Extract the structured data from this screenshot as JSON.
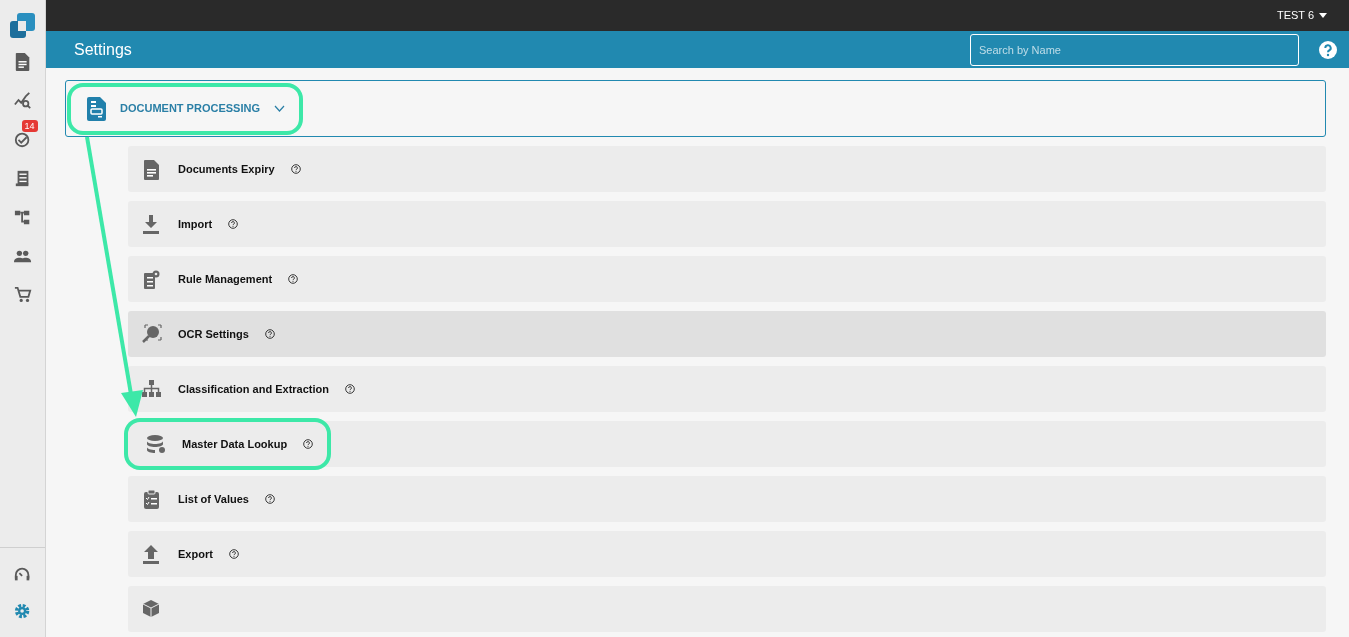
{
  "top_bar": {
    "user": "TEST 6"
  },
  "sidebar": {
    "items": [
      {
        "kind": "document",
        "selected": false
      },
      {
        "kind": "analytics",
        "selected": false
      },
      {
        "kind": "tasks",
        "selected": false,
        "badge": "14"
      },
      {
        "kind": "receipt",
        "selected": false
      },
      {
        "kind": "workflow",
        "selected": false
      },
      {
        "kind": "users",
        "selected": false
      },
      {
        "kind": "cart",
        "selected": false
      }
    ],
    "bottom_items": [
      {
        "kind": "support",
        "selected": false
      },
      {
        "kind": "settings",
        "selected": true
      }
    ]
  },
  "header": {
    "title": "Settings",
    "search": {
      "placeholder": "Search by Name"
    }
  },
  "section": {
    "title": "DOCUMENT PROCESSING",
    "expanded": true,
    "callout": true
  },
  "items": [
    {
      "kind": "document",
      "label": "Documents Expiry",
      "highlighted": false,
      "callout": false
    },
    {
      "kind": "import",
      "label": "Import",
      "highlighted": false,
      "callout": false
    },
    {
      "kind": "rules",
      "label": "Rule Management",
      "highlighted": false,
      "callout": false
    },
    {
      "kind": "ocr",
      "label": "OCR Settings",
      "highlighted": true,
      "callout": false
    },
    {
      "kind": "hierarchy",
      "label": "Classification and Extraction",
      "highlighted": false,
      "callout": false
    },
    {
      "kind": "database",
      "label": "Master Data Lookup",
      "highlighted": false,
      "callout": true
    },
    {
      "kind": "list",
      "label": "List of Values",
      "highlighted": false,
      "callout": false
    },
    {
      "kind": "export",
      "label": "Export",
      "highlighted": false,
      "callout": false
    },
    {
      "kind": "cube",
      "highlighted": false,
      "callout": false
    }
  ]
}
